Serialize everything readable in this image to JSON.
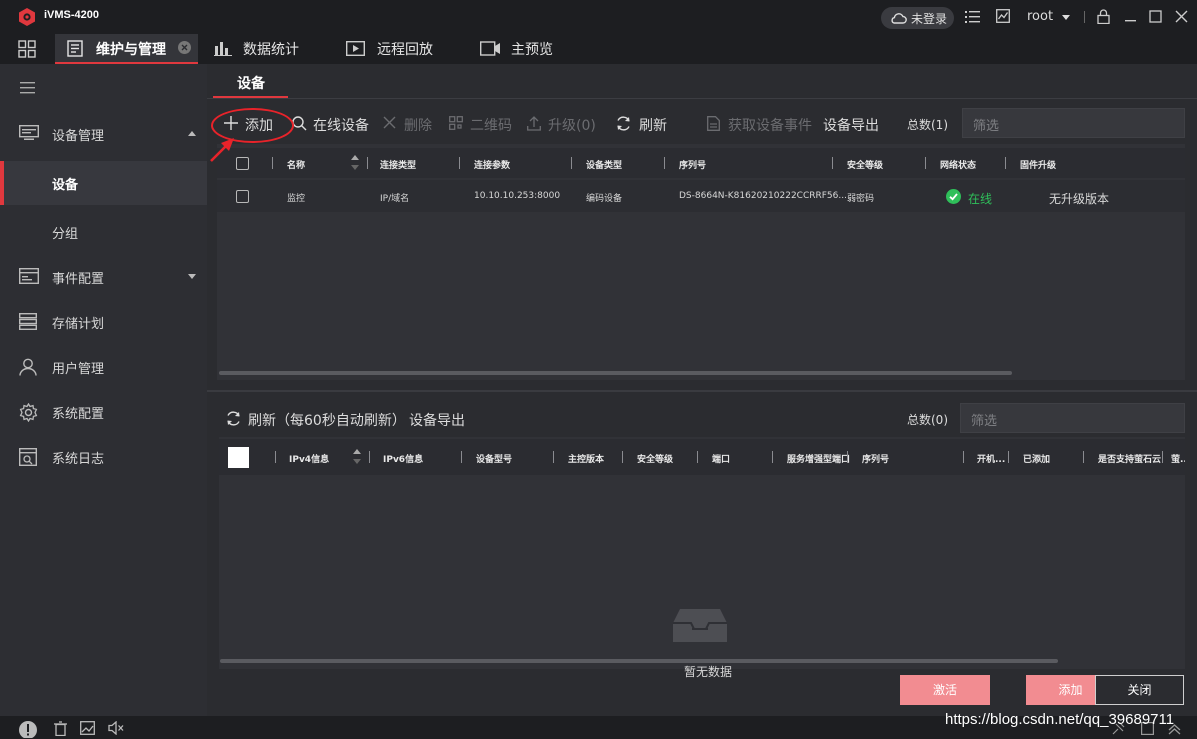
{
  "app": {
    "title": "iVMS-4200"
  },
  "titlebar": {
    "login_status": "未登录",
    "user": "root"
  },
  "tabs": [
    {
      "label": "维护与管理",
      "active": true
    },
    {
      "label": "数据统计"
    },
    {
      "label": "远程回放"
    },
    {
      "label": "主预览"
    }
  ],
  "sidebar": {
    "items": [
      {
        "label": "设备管理",
        "expanded": true
      },
      {
        "label": "设备",
        "active": true
      },
      {
        "label": "分组"
      },
      {
        "label": "事件配置"
      },
      {
        "label": "存储计划"
      },
      {
        "label": "用户管理"
      },
      {
        "label": "系统配置"
      },
      {
        "label": "系统日志"
      }
    ]
  },
  "main": {
    "subtab": "设备",
    "toolbar": {
      "add": "添加",
      "online": "在线设备",
      "delete": "删除",
      "qrcode": "二维码",
      "upgrade": "升级(0)",
      "refresh": "刷新",
      "get_events": "获取设备事件",
      "export": "设备导出",
      "total": "总数(1)",
      "filter_placeholder": "筛选"
    },
    "device_table": {
      "columns": [
        "名称",
        "连接类型",
        "连接参数",
        "设备类型",
        "序列号",
        "安全等级",
        "网络状态",
        "固件升级"
      ],
      "rows": [
        {
          "name": "监控",
          "conn_type": "IP/域名",
          "conn_param": "10.10.10.253:8000",
          "device_type": "编码设备",
          "serial": "DS-8664N-K81620210222CCRRF56...",
          "security": "弱密码",
          "status": "在线",
          "firmware": "无升级版本"
        }
      ]
    },
    "online_panel": {
      "refresh": "刷新（每60秒自动刷新）",
      "export": "设备导出",
      "total": "总数(0)",
      "filter_placeholder": "筛选",
      "columns": [
        "IPv4信息",
        "IPv6信息",
        "设备型号",
        "主控版本",
        "安全等级",
        "端口",
        "服务增强型端口",
        "序列号",
        "开机...",
        "已添加",
        "是否支持萤石云",
        "萤..."
      ],
      "empty": "暂无数据"
    },
    "buttons": {
      "activate": "激活",
      "add": "添加",
      "close": "关闭"
    }
  },
  "watermark": "https://blog.csdn.net/qq_39689711",
  "colors": {
    "accent": "#e0383e",
    "online": "#2fbf5a",
    "pink_button": "#f28c91"
  }
}
